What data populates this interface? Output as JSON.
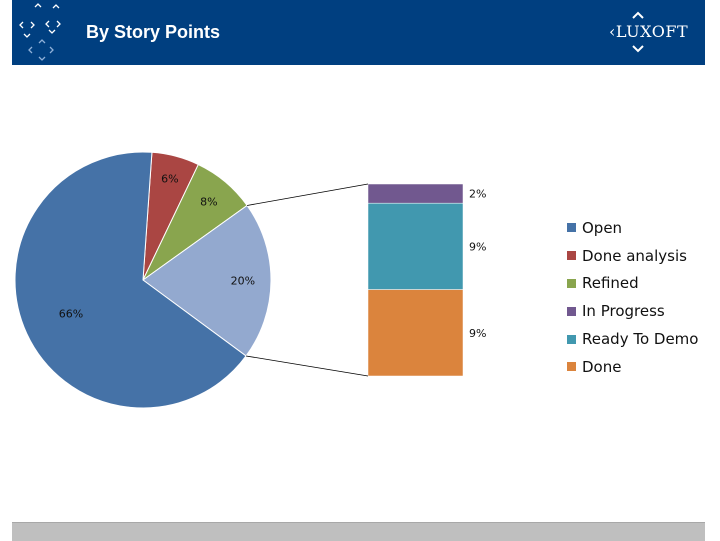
{
  "header": {
    "title": "By Story Points",
    "logo_text": "LUXOFT",
    "background": "#003f80"
  },
  "chart_data": {
    "type": "pie",
    "subtype": "pie-of-pie",
    "pie": [
      {
        "name": "Open",
        "value": 66,
        "label": "66%",
        "color": "#4572a7"
      },
      {
        "name": "Done analysis",
        "value": 6,
        "label": "6%",
        "color": "#aa4643"
      },
      {
        "name": "Refined",
        "value": 8,
        "label": "8%",
        "color": "#89a54e"
      },
      {
        "name": "",
        "value": 20,
        "label": "20%",
        "color": "#93a9cf"
      }
    ],
    "secondary_bar": [
      {
        "name": "In Progress",
        "value": 2,
        "label": "2%",
        "color": "#71588f"
      },
      {
        "name": "Ready To Demo",
        "value": 9,
        "label": "9%",
        "color": "#4198af"
      },
      {
        "name": "Done",
        "value": 9,
        "label": "9%",
        "color": "#db843d"
      }
    ],
    "legend": {
      "placement": "right",
      "items": [
        {
          "label": "Open",
          "color": "#4572a7"
        },
        {
          "label": "Done analysis",
          "color": "#aa4643"
        },
        {
          "label": "Refined",
          "color": "#89a54e"
        },
        {
          "label": "In Progress",
          "color": "#71588f"
        },
        {
          "label": "Ready To Demo",
          "color": "#4198af"
        },
        {
          "label": "Done",
          "color": "#db843d"
        }
      ]
    }
  }
}
